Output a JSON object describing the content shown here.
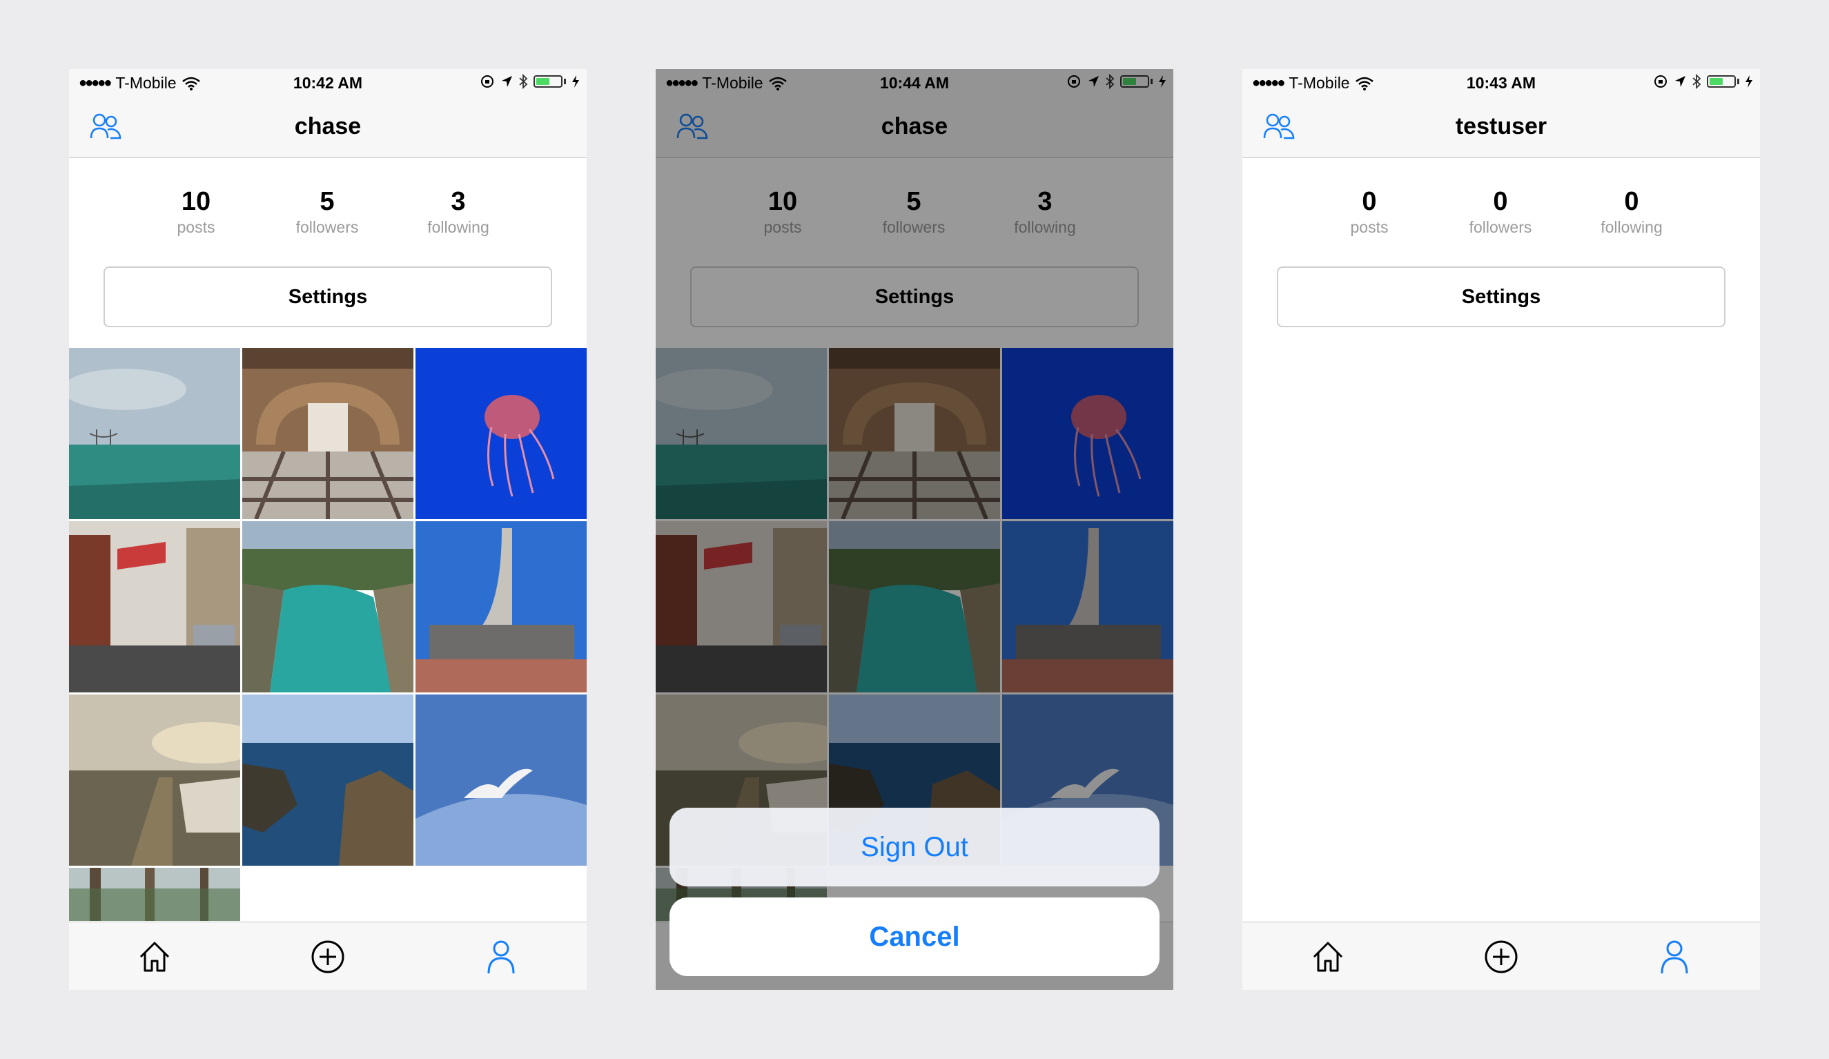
{
  "colors": {
    "accent": "#147EFB",
    "tile_bg": "#FFFFFF",
    "label": "#9B9B9B"
  },
  "screens": [
    {
      "status": {
        "carrier": "T-Mobile",
        "time": "10:42 AM"
      },
      "title": "chase",
      "stats": [
        {
          "value": "10",
          "label": "posts"
        },
        {
          "value": "5",
          "label": "followers"
        },
        {
          "value": "3",
          "label": "following"
        }
      ],
      "settings_label": "Settings"
    },
    {
      "status": {
        "carrier": "T-Mobile",
        "time": "10:44 AM"
      },
      "title": "chase",
      "stats": [
        {
          "value": "10",
          "label": "posts"
        },
        {
          "value": "5",
          "label": "followers"
        },
        {
          "value": "3",
          "label": "following"
        }
      ],
      "settings_label": "Settings",
      "action_sheet": {
        "sign_out_label": "Sign Out",
        "cancel_label": "Cancel"
      }
    },
    {
      "status": {
        "carrier": "T-Mobile",
        "time": "10:43 AM"
      },
      "title": "testuser",
      "stats": [
        {
          "value": "0",
          "label": "posts"
        },
        {
          "value": "0",
          "label": "followers"
        },
        {
          "value": "0",
          "label": "following"
        }
      ],
      "settings_label": "Settings"
    }
  ],
  "tabs": [
    {
      "icon": "home-icon"
    },
    {
      "icon": "add-circle-icon"
    },
    {
      "icon": "profile-icon"
    }
  ],
  "photos": [
    {
      "subject": "bay-with-bridge-icon"
    },
    {
      "subject": "arched-corridor-icon"
    },
    {
      "subject": "jellyfish-icon"
    },
    {
      "subject": "street-with-flags-icon"
    },
    {
      "subject": "cove-icon"
    },
    {
      "subject": "tower-building-icon"
    },
    {
      "subject": "beach-boardwalk-icon"
    },
    {
      "subject": "rocky-coast-icon"
    },
    {
      "subject": "seagull-icon"
    },
    {
      "subject": "forest-icon"
    }
  ]
}
